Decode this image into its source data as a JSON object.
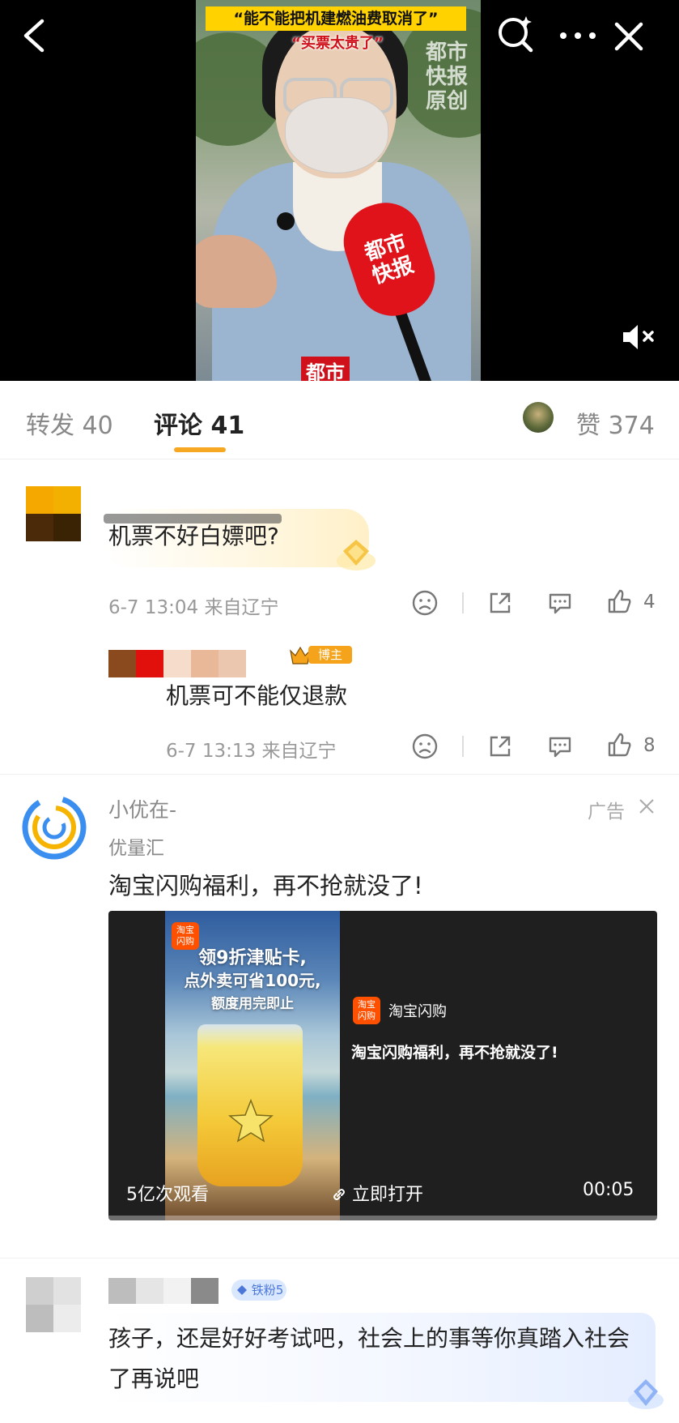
{
  "video": {
    "banner_title": "“能不能把机建燃油费取消了”",
    "banner_subtitle": "“买票太贵了”",
    "watermark": "都市\n快报\n原创",
    "mic_text": "都市\n快报",
    "bottom_logo": "都市"
  },
  "tabs": {
    "repost_label": "转发 40",
    "comments_label": "评论 41",
    "likes_label": "赞 374"
  },
  "comments": [
    {
      "text": "机票不好白嫖吧?",
      "meta": "6-7 13:04  来自辽宁",
      "like_count": "4"
    },
    {
      "badge": "博主",
      "text": "机票可不能仅退款",
      "meta": "6-7 13:13  来自辽宁",
      "like_count": "8"
    }
  ],
  "ad": {
    "account_name": "小优在-",
    "sub_name": "优量汇",
    "ad_label": "广告",
    "headline": "淘宝闪购福利，再不抢就没了!",
    "poster_brand": "淘宝\n闪购",
    "poster_line1": "领9折津贴卡,",
    "poster_line2": "点外卖可省100元,",
    "poster_line3": "额度用完即止",
    "app_icon_text": "淘宝\n闪购",
    "app_name": "淘宝闪购",
    "video_slogan": "淘宝闪购福利，再不抢就没了!",
    "views": "5亿次观看",
    "open_label": "立即打开",
    "duration": "00:05"
  },
  "comment3": {
    "fan_badge": "铁粉5",
    "text": "孩子，还是好好考试吧，社会上的事等你真踏入社会了再说吧"
  },
  "colors": {
    "accent": "#f7a823",
    "vip_orange": "#f5a31a",
    "brand_red": "#ff5000",
    "fan_blue": "#4b78d8"
  },
  "icons": [
    "back-icon",
    "search-icon",
    "more-icon",
    "close-icon",
    "mute-icon",
    "dislike-icon",
    "share-icon",
    "reply-icon",
    "like-icon",
    "ad-close-icon",
    "link-icon"
  ]
}
